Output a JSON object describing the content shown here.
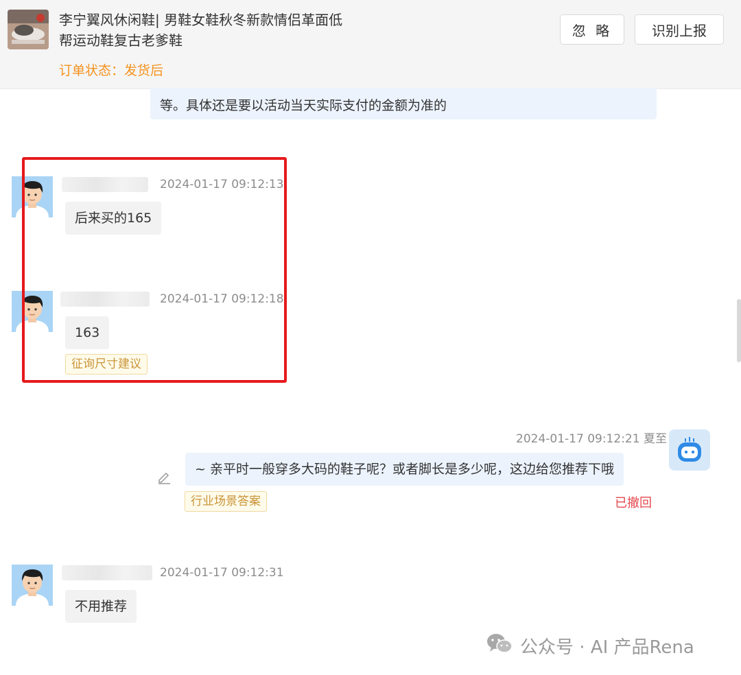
{
  "header": {
    "product_title": "李宁翼风休闲鞋| 男鞋女鞋秋冬新款情侣革面低帮运动鞋复古老爹鞋",
    "order_status": "订单状态：发货后",
    "ignore_label": "忽 略",
    "report_label": "识别上报"
  },
  "messages": {
    "partial_text": "等。具体还是要以活动当天实际支付的金额为准的",
    "m1": {
      "time": "2024-01-17 09:12:13",
      "text": "后来买的165"
    },
    "m2": {
      "time": "2024-01-17 09:12:18",
      "text": "163",
      "tag": "征询尺寸建议"
    },
    "m3": {
      "time_sender": "2024-01-17 09:12:21 夏至",
      "text": "~ 亲平时一般穿多大码的鞋子呢？或者脚长是多少呢，这边给您推荐下哦",
      "tag": "行业场景答案",
      "status": "已撤回"
    },
    "m4": {
      "time": "2024-01-17 09:12:31",
      "text": "不用推荐"
    }
  },
  "watermark": {
    "text": "公众号 · AI 产品Rena"
  },
  "colors": {
    "accent_orange": "#f5931f",
    "highlight_red": "#e5191c",
    "revoked_red": "#e5484d",
    "agent_bubble": "#ecf3fd",
    "customer_bubble": "#f2f2f2"
  },
  "icons": [
    "product-thumbnail",
    "user-avatar-icon",
    "bot-avatar-icon",
    "edit-pencil-icon",
    "wechat-icon"
  ]
}
